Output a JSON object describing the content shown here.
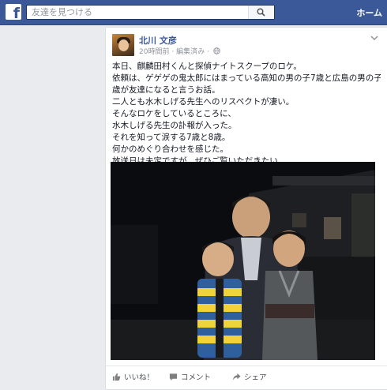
{
  "topbar": {
    "logo_letter": "f",
    "search_placeholder": "友達を見つける",
    "home_label": "ホーム"
  },
  "post": {
    "author": "北川 文彦",
    "time": "20時間前",
    "separator": "·",
    "edited": "編集済み",
    "privacy_icon": "globe-icon",
    "lines": [
      "本日、麒麟田村くんと探偵ナイトスクープのロケ。",
      "依頼は、ゲゲゲの鬼太郎にはまっている高知の男の子7歳と広島の男の子8",
      "歳が友達になると言うお話。",
      "二人とも水木しげる先生へのリスペクトが凄い。",
      "そんなロケをしているところに、",
      "水木しげる先生の訃報が入った。",
      "それを知って涙する7歳と8歳。",
      "何かのめぐり合わせを感じた。",
      "放送日は未定ですが、ぜひご覧いただきたい。"
    ]
  },
  "actions": {
    "like": "いいね！",
    "comment": "コメント",
    "share": "シェア"
  },
  "colors": {
    "brand": "#3b5998",
    "link": "#3b5998",
    "meta": "#90949c"
  }
}
